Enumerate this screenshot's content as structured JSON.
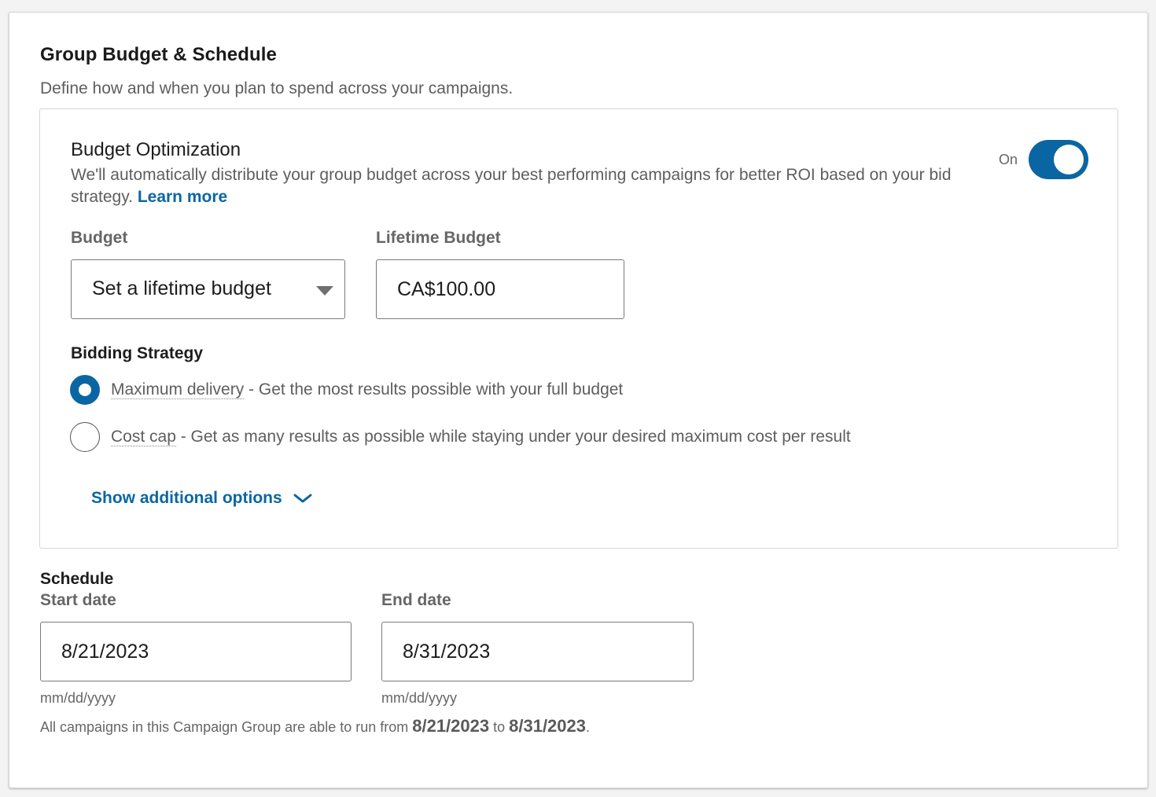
{
  "section": {
    "title": "Group Budget & Schedule",
    "description": "Define how and when you plan to spend across your campaigns."
  },
  "budget_optimization": {
    "title": "Budget Optimization",
    "description": "We'll automatically distribute your group budget across your best performing campaigns for better ROI based on your bid strategy.",
    "learn_more": "Learn more",
    "toggle_label": "On",
    "toggle_on": true,
    "toggle_color": "#0a66a3"
  },
  "budget": {
    "label": "Budget",
    "selected": "Set a lifetime budget",
    "icon": "chevron-down-icon"
  },
  "lifetime_budget": {
    "label": "Lifetime Budget",
    "value": "CA$100.00"
  },
  "bidding": {
    "title": "Bidding Strategy",
    "options": [
      {
        "term": "Maximum delivery",
        "description": " - Get the most results possible with your full budget",
        "checked": true
      },
      {
        "term": "Cost cap",
        "description": " - Get as many results as possible while staying under your desired maximum cost per result",
        "checked": false
      }
    ],
    "show_more": "Show additional options"
  },
  "schedule": {
    "title": "Schedule",
    "start_label": "Start date",
    "start_value": "8/21/2023",
    "start_hint": "mm/dd/yyyy",
    "end_label": "End date",
    "end_value": "8/31/2023",
    "end_hint": "mm/dd/yyyy",
    "summary_prefix": "All campaigns in this Campaign Group are able to run from ",
    "summary_start": "8/21/2023",
    "summary_mid": " to ",
    "summary_end": "8/31/2023",
    "summary_suffix": "."
  }
}
